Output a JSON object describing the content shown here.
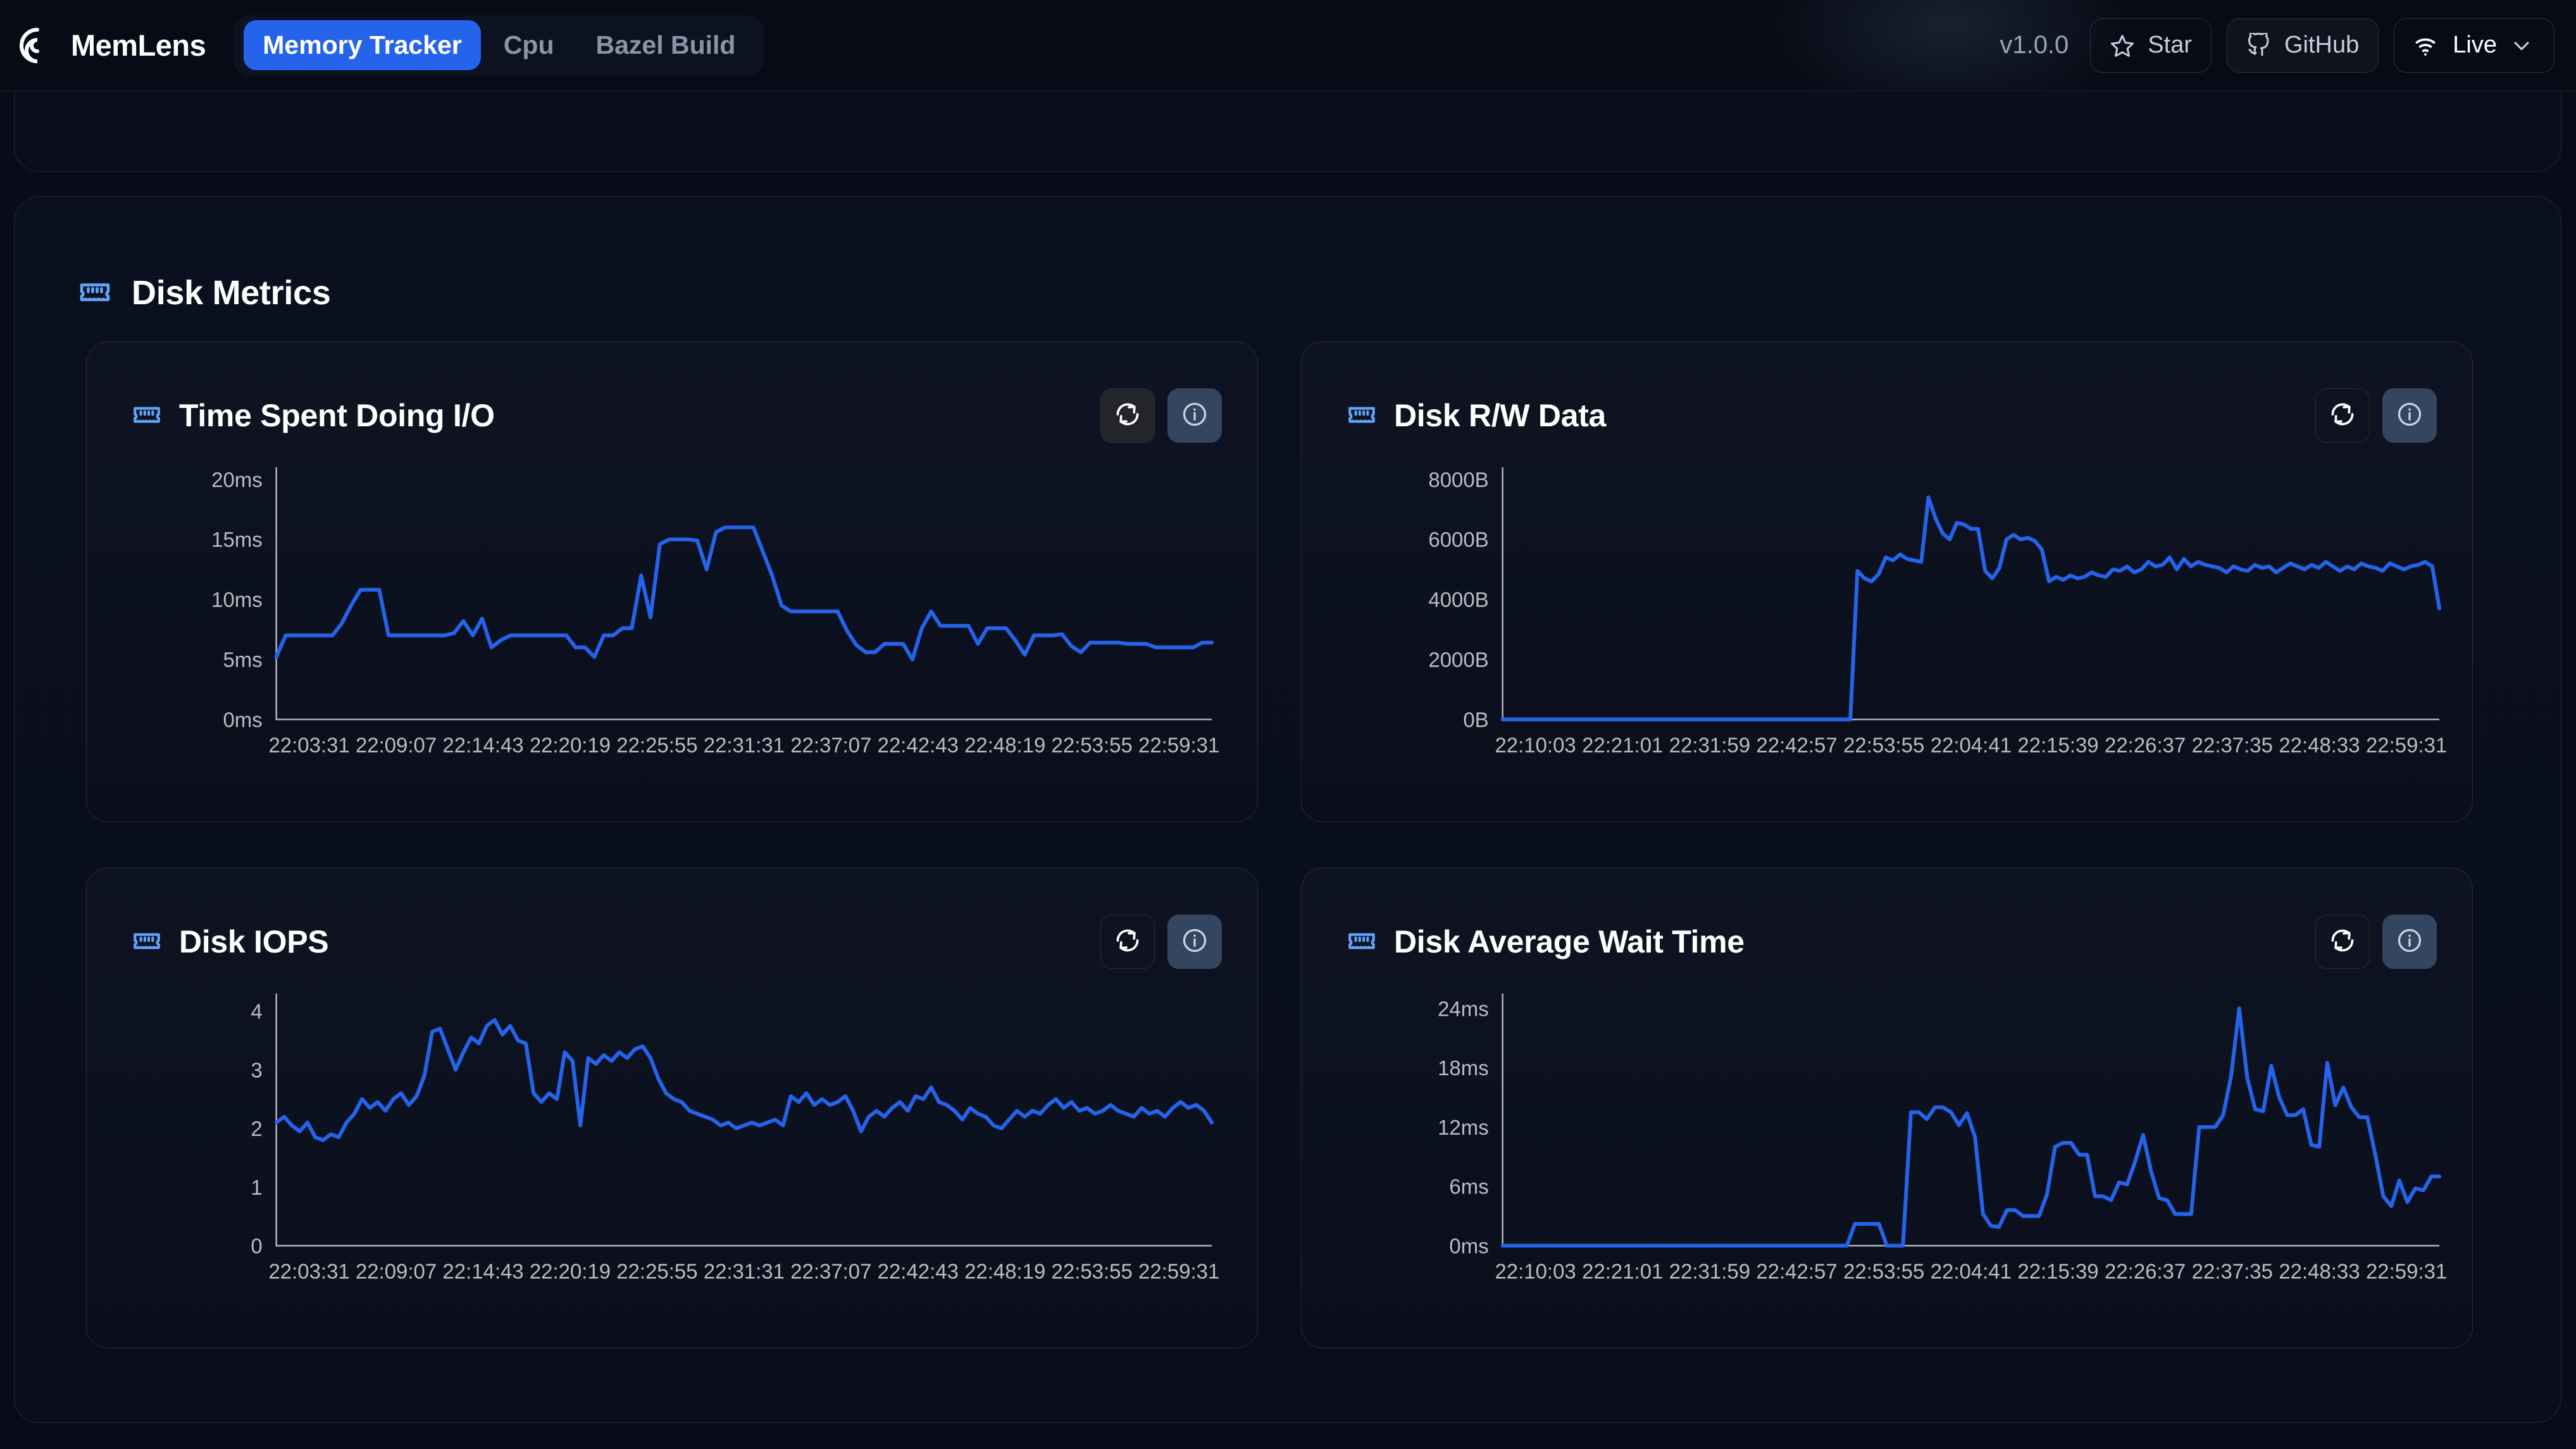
{
  "header": {
    "brand": "MemLens",
    "logo_icon": "memlens-spiral-logo",
    "tabs": [
      {
        "label": "Memory Tracker",
        "active": true
      },
      {
        "label": "Cpu",
        "active": false
      },
      {
        "label": "Bazel Build",
        "active": false
      }
    ],
    "version": "v1.0.0",
    "star_label": "Star",
    "star_icon": "star-icon",
    "github_label": "GitHub",
    "github_icon": "github-icon",
    "live_label": "Live",
    "live_icon": "wifi-icon",
    "live_chevron_icon": "chevron-down-icon"
  },
  "section": {
    "title": "Disk Metrics",
    "icon": "memory-stick-icon"
  },
  "card_actions": {
    "refresh_icon": "refresh-icon",
    "info_icon": "info-icon"
  },
  "colors": {
    "accent_blue": "#2563eb",
    "icon_blue": "#60a5fa",
    "page_bg": "#080c18",
    "card_bg": "#0e1322",
    "info_btn_bg": "#33455f",
    "tick_text": "#b9bcc2"
  },
  "chart_data": [
    {
      "id": "time-spent-doing-io",
      "type": "line",
      "title": "Time Spent Doing I/O",
      "xlabel": "",
      "ylabel": "",
      "ylim": [
        0,
        21
      ],
      "yticks": [
        0,
        5,
        10,
        15,
        20
      ],
      "ytick_labels": [
        "0ms",
        "5ms",
        "10ms",
        "15ms",
        "20ms"
      ],
      "xtick_labels": [
        "22:03:31",
        "22:09:07",
        "22:14:43",
        "22:20:19",
        "22:25:55",
        "22:31:31",
        "22:37:07",
        "22:42:43",
        "22:48:19",
        "22:53:55",
        "22:59:31"
      ],
      "grid": false,
      "legend": "none",
      "series": [
        {
          "name": "io_time",
          "color": "#2563eb",
          "values": [
            5.2,
            7,
            7,
            7,
            7,
            7,
            7,
            8,
            9.5,
            10.8,
            10.8,
            10.8,
            7,
            7,
            7,
            7,
            7,
            7,
            7,
            7.2,
            8.2,
            7,
            8.4,
            6,
            6.6,
            7,
            7,
            7,
            7,
            7,
            7,
            7,
            6,
            6,
            5.2,
            7,
            7,
            7.6,
            7.6,
            12,
            8.5,
            14.6,
            15,
            15,
            15,
            14.9,
            12.5,
            15.6,
            16,
            16,
            16,
            16,
            14,
            12,
            9.5,
            9,
            9,
            9,
            9,
            9,
            9,
            7.4,
            6.2,
            5.6,
            5.6,
            6.3,
            6.3,
            6.3,
            5,
            7.6,
            9,
            7.8,
            7.8,
            7.8,
            7.8,
            6.3,
            7.6,
            7.6,
            7.6,
            6.6,
            5.4,
            7,
            7,
            7,
            7.1,
            6.1,
            5.6,
            6.4,
            6.4,
            6.4,
            6.4,
            6.3,
            6.3,
            6.3,
            6,
            6,
            6,
            6,
            6,
            6.4,
            6.4
          ]
        }
      ]
    },
    {
      "id": "disk-rw-data",
      "type": "line",
      "title": "Disk R/W Data",
      "xlabel": "",
      "ylabel": "",
      "ylim": [
        0,
        8400
      ],
      "yticks": [
        0,
        2000,
        4000,
        6000,
        8000
      ],
      "ytick_labels": [
        "0B",
        "2000B",
        "4000B",
        "6000B",
        "8000B"
      ],
      "xtick_labels": [
        "22:10:03",
        "22:21:01",
        "22:31:59",
        "22:42:57",
        "22:53:55",
        "22:04:41",
        "22:15:39",
        "22:26:37",
        "22:37:35",
        "22:48:33",
        "22:59:31"
      ],
      "grid": false,
      "legend": "none",
      "series": [
        {
          "name": "rw_bytes",
          "color": "#2563eb",
          "values": [
            0,
            0,
            0,
            0,
            0,
            0,
            0,
            0,
            0,
            0,
            0,
            0,
            0,
            0,
            0,
            0,
            0,
            0,
            0,
            0,
            0,
            0,
            0,
            0,
            0,
            0,
            0,
            0,
            0,
            0,
            0,
            0,
            0,
            0,
            0,
            0,
            0,
            0,
            0,
            0,
            0,
            0,
            0,
            0,
            0,
            0,
            0,
            0,
            0,
            0,
            4950,
            4700,
            4600,
            4850,
            5400,
            5300,
            5500,
            5350,
            5300,
            5250,
            7400,
            6700,
            6200,
            6000,
            6550,
            6500,
            6350,
            6350,
            4950,
            4700,
            5050,
            6000,
            6150,
            6000,
            6050,
            5950,
            5650,
            4600,
            4750,
            4650,
            4800,
            4700,
            4750,
            4900,
            4800,
            4750,
            5000,
            4950,
            5100,
            4900,
            5000,
            5250,
            5100,
            5150,
            5400,
            5000,
            5350,
            5100,
            5250,
            5150,
            5100,
            5050,
            4900,
            5100,
            5000,
            4950,
            5150,
            5050,
            5100,
            4900,
            5050,
            5200,
            5100,
            5000,
            5150,
            5050,
            5250,
            5100,
            4950,
            5100,
            5000,
            5200,
            5100,
            5050,
            4950,
            5200,
            5100,
            5000,
            5100,
            5150,
            5250,
            5100,
            3700
          ]
        }
      ]
    },
    {
      "id": "disk-iops",
      "type": "line",
      "title": "Disk IOPS",
      "xlabel": "",
      "ylabel": "",
      "ylim": [
        0,
        4.3
      ],
      "yticks": [
        0,
        1,
        2,
        3,
        4
      ],
      "ytick_labels": [
        "0",
        "1",
        "2",
        "3",
        "4"
      ],
      "xtick_labels": [
        "22:03:31",
        "22:09:07",
        "22:14:43",
        "22:20:19",
        "22:25:55",
        "22:31:31",
        "22:37:07",
        "22:42:43",
        "22:48:19",
        "22:53:55",
        "22:59:31"
      ],
      "grid": false,
      "legend": "none",
      "series": [
        {
          "name": "iops",
          "color": "#2563eb",
          "values": [
            2.1,
            2.2,
            2.05,
            1.95,
            2.1,
            1.85,
            1.8,
            1.9,
            1.85,
            2.1,
            2.25,
            2.5,
            2.35,
            2.45,
            2.3,
            2.5,
            2.6,
            2.4,
            2.55,
            2.9,
            3.65,
            3.7,
            3.35,
            3.0,
            3.3,
            3.55,
            3.45,
            3.75,
            3.85,
            3.6,
            3.75,
            3.5,
            3.45,
            2.6,
            2.45,
            2.6,
            2.5,
            3.3,
            3.15,
            2.05,
            3.2,
            3.1,
            3.25,
            3.15,
            3.3,
            3.2,
            3.35,
            3.4,
            3.2,
            2.85,
            2.6,
            2.5,
            2.45,
            2.3,
            2.25,
            2.2,
            2.15,
            2.05,
            2.1,
            2.0,
            2.05,
            2.1,
            2.05,
            2.1,
            2.15,
            2.05,
            2.55,
            2.45,
            2.6,
            2.4,
            2.5,
            2.4,
            2.45,
            2.55,
            2.3,
            1.95,
            2.2,
            2.3,
            2.2,
            2.35,
            2.45,
            2.3,
            2.55,
            2.5,
            2.7,
            2.45,
            2.4,
            2.3,
            2.15,
            2.35,
            2.25,
            2.2,
            2.05,
            2.0,
            2.15,
            2.3,
            2.2,
            2.3,
            2.25,
            2.4,
            2.5,
            2.35,
            2.45,
            2.3,
            2.35,
            2.25,
            2.3,
            2.4,
            2.3,
            2.25,
            2.2,
            2.35,
            2.25,
            2.3,
            2.2,
            2.35,
            2.45,
            2.35,
            2.4,
            2.3,
            2.1
          ]
        }
      ]
    },
    {
      "id": "disk-average-wait-time",
      "type": "line",
      "title": "Disk Average Wait Time",
      "xlabel": "",
      "ylabel": "",
      "ylim": [
        0,
        25.5
      ],
      "yticks": [
        0,
        6,
        12,
        18,
        24
      ],
      "ytick_labels": [
        "0ms",
        "6ms",
        "12ms",
        "18ms",
        "24ms"
      ],
      "xtick_labels": [
        "22:10:03",
        "22:21:01",
        "22:31:59",
        "22:42:57",
        "22:53:55",
        "22:04:41",
        "22:15:39",
        "22:26:37",
        "22:37:35",
        "22:48:33",
        "22:59:31"
      ],
      "grid": false,
      "legend": "none",
      "series": [
        {
          "name": "avg_wait",
          "color": "#2563eb",
          "values": [
            0,
            0,
            0,
            0,
            0,
            0,
            0,
            0,
            0,
            0,
            0,
            0,
            0,
            0,
            0,
            0,
            0,
            0,
            0,
            0,
            0,
            0,
            0,
            0,
            0,
            0,
            0,
            0,
            0,
            0,
            0,
            0,
            0,
            0,
            0,
            0,
            0,
            0,
            0,
            0,
            0,
            0,
            0,
            0,
            2.2,
            2.2,
            2.2,
            2.2,
            0,
            0,
            0,
            13.5,
            13.5,
            12.8,
            14.0,
            14.0,
            13.5,
            12.2,
            13.4,
            11.0,
            3.2,
            2.0,
            1.9,
            3.6,
            3.6,
            3.0,
            3.0,
            3.0,
            5.2,
            10.0,
            10.4,
            10.4,
            9.2,
            9.2,
            5.0,
            5.0,
            4.6,
            6.4,
            6.2,
            8.5,
            11.2,
            7.5,
            4.8,
            4.6,
            3.2,
            3.2,
            3.2,
            12.0,
            12.0,
            12.0,
            13.2,
            17.2,
            24.0,
            17.0,
            13.8,
            13.6,
            18.2,
            15.0,
            13.2,
            13.2,
            13.8,
            10.2,
            10.0,
            18.5,
            14.2,
            16.0,
            14.0,
            13.0,
            13.0,
            9.2,
            5.0,
            4.0,
            6.6,
            4.4,
            5.8,
            5.6,
            7.0,
            7.0
          ]
        }
      ]
    }
  ]
}
